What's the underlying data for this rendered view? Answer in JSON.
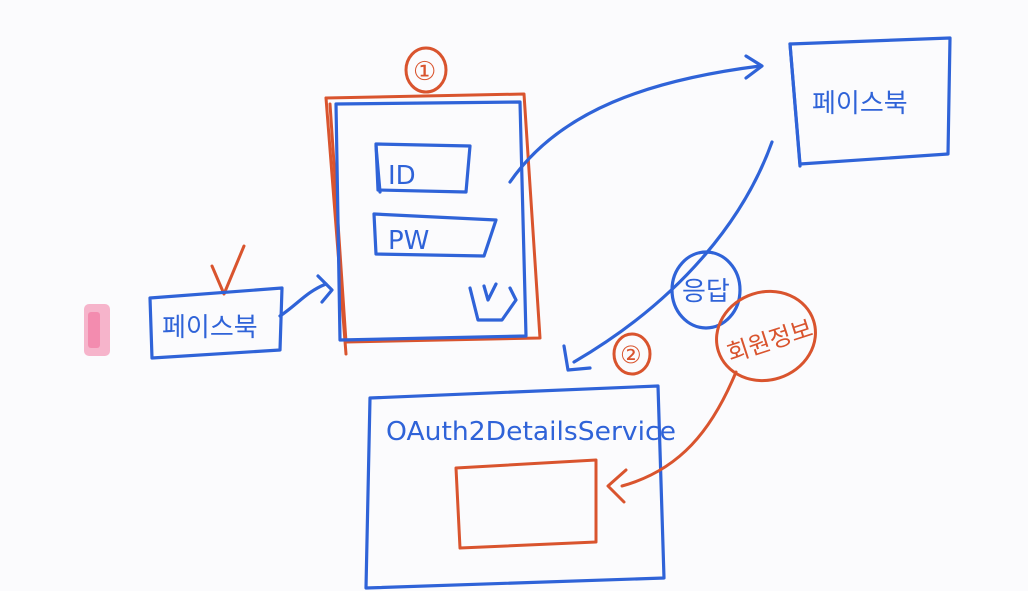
{
  "labels": {
    "facebook": "페이스북",
    "login_step": "①",
    "id_field": "ID",
    "pw_field": "PW",
    "server_facebook": "페이스북",
    "response": "응답",
    "service_step": "②",
    "service": "OAuth2DetailsService",
    "user_info": "회원정보"
  },
  "colors": {
    "blue": "#2f63d8",
    "red": "#d9542e",
    "highlight": "#f37aa3"
  }
}
